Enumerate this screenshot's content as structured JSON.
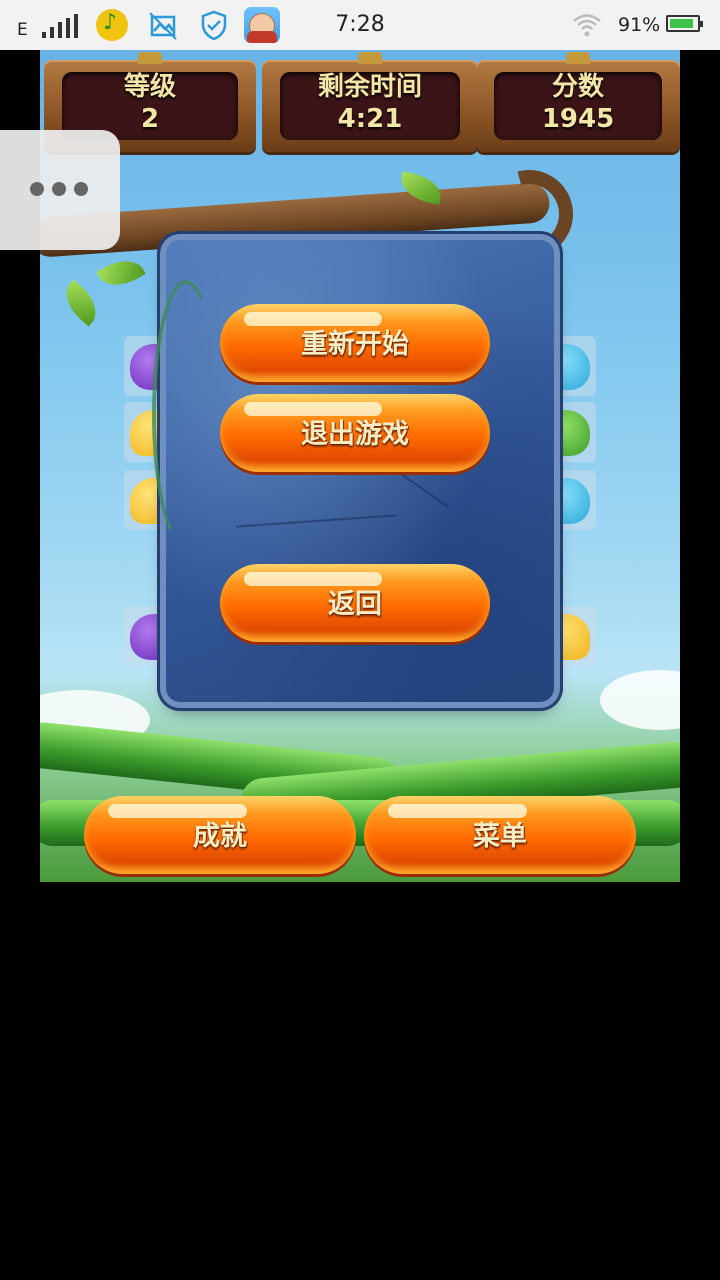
{
  "status_bar": {
    "network_type": "E",
    "time": "7:28",
    "battery_percent": "91%",
    "battery_level": 0.91,
    "icons": [
      "signal-icon",
      "music-app-icon",
      "image-edit-icon",
      "shield-icon",
      "game-avatar-icon",
      "wifi-icon",
      "battery-icon"
    ]
  },
  "hud": {
    "level": {
      "label": "等级",
      "value": "2"
    },
    "time_left": {
      "label": "剩余时间",
      "value": "4:21"
    },
    "score": {
      "label": "分数",
      "value": "1945"
    }
  },
  "pause_dialog": {
    "restart_label": "重新开始",
    "exit_label": "退出游戏",
    "back_label": "返回"
  },
  "bottom_buttons": {
    "achievements_label": "成就",
    "menu_label": "菜单"
  },
  "colors": {
    "button_orange": "#ff6a00",
    "button_text": "#f6edc4",
    "panel_text": "#f3e6a6",
    "dialog_blue": "#34599a",
    "panel_wood": "#8a5424"
  },
  "floating_menu": {
    "icon": "more-dots-icon"
  }
}
